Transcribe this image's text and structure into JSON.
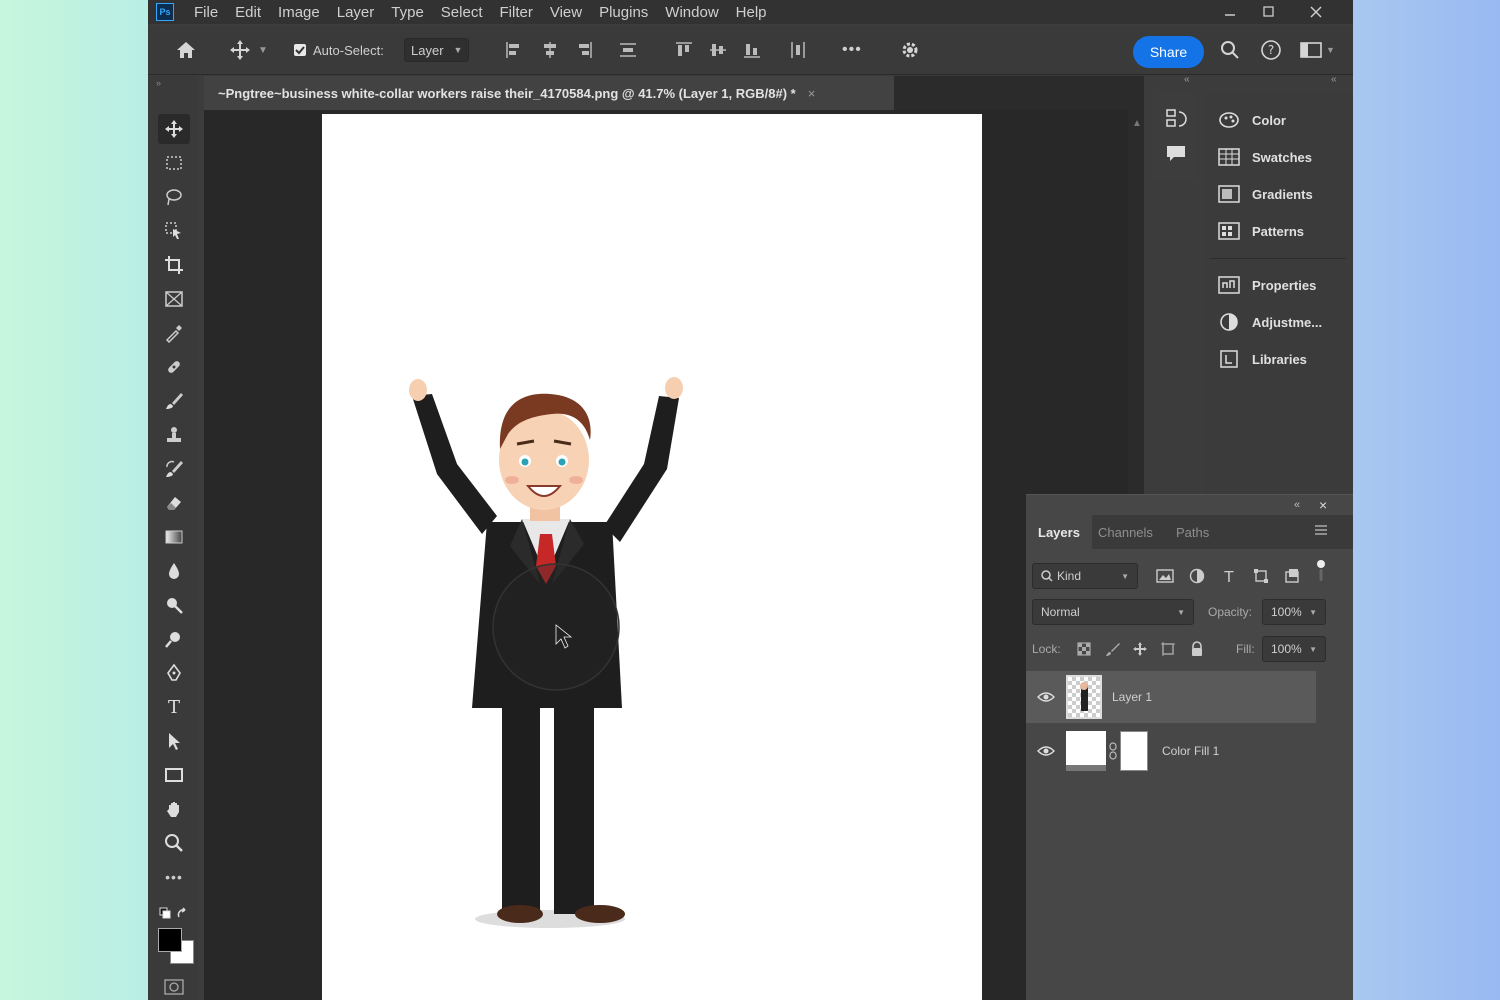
{
  "menu": [
    "File",
    "Edit",
    "Image",
    "Layer",
    "Type",
    "Select",
    "Filter",
    "View",
    "Plugins",
    "Window",
    "Help"
  ],
  "app_logo": "Ps",
  "options_bar": {
    "auto_select_label": "Auto-Select:",
    "auto_select_checked": true,
    "layer_dropdown": "Layer",
    "more": "•••",
    "share_label": "Share"
  },
  "document_tab": {
    "title": "~Pngtree~business white-collar workers raise their_4170584.png @ 41.7% (Layer 1, RGB/8#) *",
    "close": "×"
  },
  "right_panels": {
    "group1": [
      "Color",
      "Swatches",
      "Gradients",
      "Patterns"
    ],
    "group2": [
      "Properties",
      "Adjustme...",
      "Libraries"
    ]
  },
  "layers_panel": {
    "tabs": [
      "Layers",
      "Channels",
      "Paths"
    ],
    "filter_kind": "Kind",
    "blend_mode": "Normal",
    "opacity_label": "Opacity:",
    "opacity_value": "100%",
    "lock_label": "Lock:",
    "fill_label": "Fill:",
    "fill_value": "100%",
    "layers": [
      {
        "name": "Layer 1",
        "selected": true
      },
      {
        "name": "Color Fill 1",
        "selected": false
      }
    ]
  },
  "colors": {
    "accent": "#1473e6",
    "app_bg": "#3c3c3c",
    "canvas_bg": "#282828",
    "artboard": "#ffffff",
    "suit": "#1e1e1e",
    "tie": "#c62828",
    "hair": "#7a3a22"
  }
}
